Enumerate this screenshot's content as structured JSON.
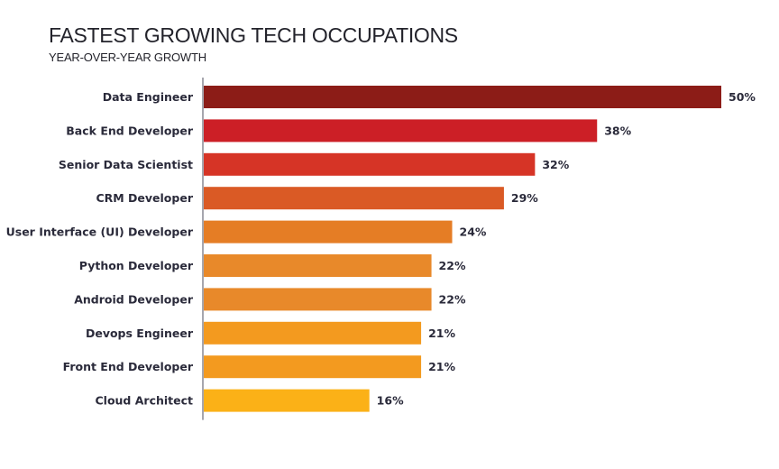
{
  "chart_data": {
    "type": "bar",
    "orientation": "horizontal",
    "title": "FASTEST GROWING TECH OCCUPATIONS",
    "subtitle": "YEAR-OVER-YEAR GROWTH",
    "xlabel": "",
    "ylabel": "",
    "grid": false,
    "legend": "none",
    "xlim": [
      0,
      50
    ],
    "value_suffix": "%",
    "categories": [
      "Data Engineer",
      "Back End Developer",
      "Senior Data Scientist",
      "CRM Developer",
      "User Interface (UI) Developer",
      "Python Developer",
      "Android Developer",
      "Devops Engineer",
      "Front End Developer",
      "Cloud Architect"
    ],
    "values": [
      50,
      38,
      32,
      29,
      24,
      22,
      22,
      21,
      21,
      16
    ],
    "data_labels": [
      "50%",
      "38%",
      "32%",
      "29%",
      "24%",
      "22%",
      "22%",
      "21%",
      "21%",
      "16%"
    ],
    "colors": [
      "#8c1c17",
      "#cc1f26",
      "#d63426",
      "#da5a25",
      "#e57d25",
      "#e8892a",
      "#e8892a",
      "#f39a1f",
      "#f39a1f",
      "#fbb117"
    ],
    "axis_color": "#6b6b78"
  }
}
